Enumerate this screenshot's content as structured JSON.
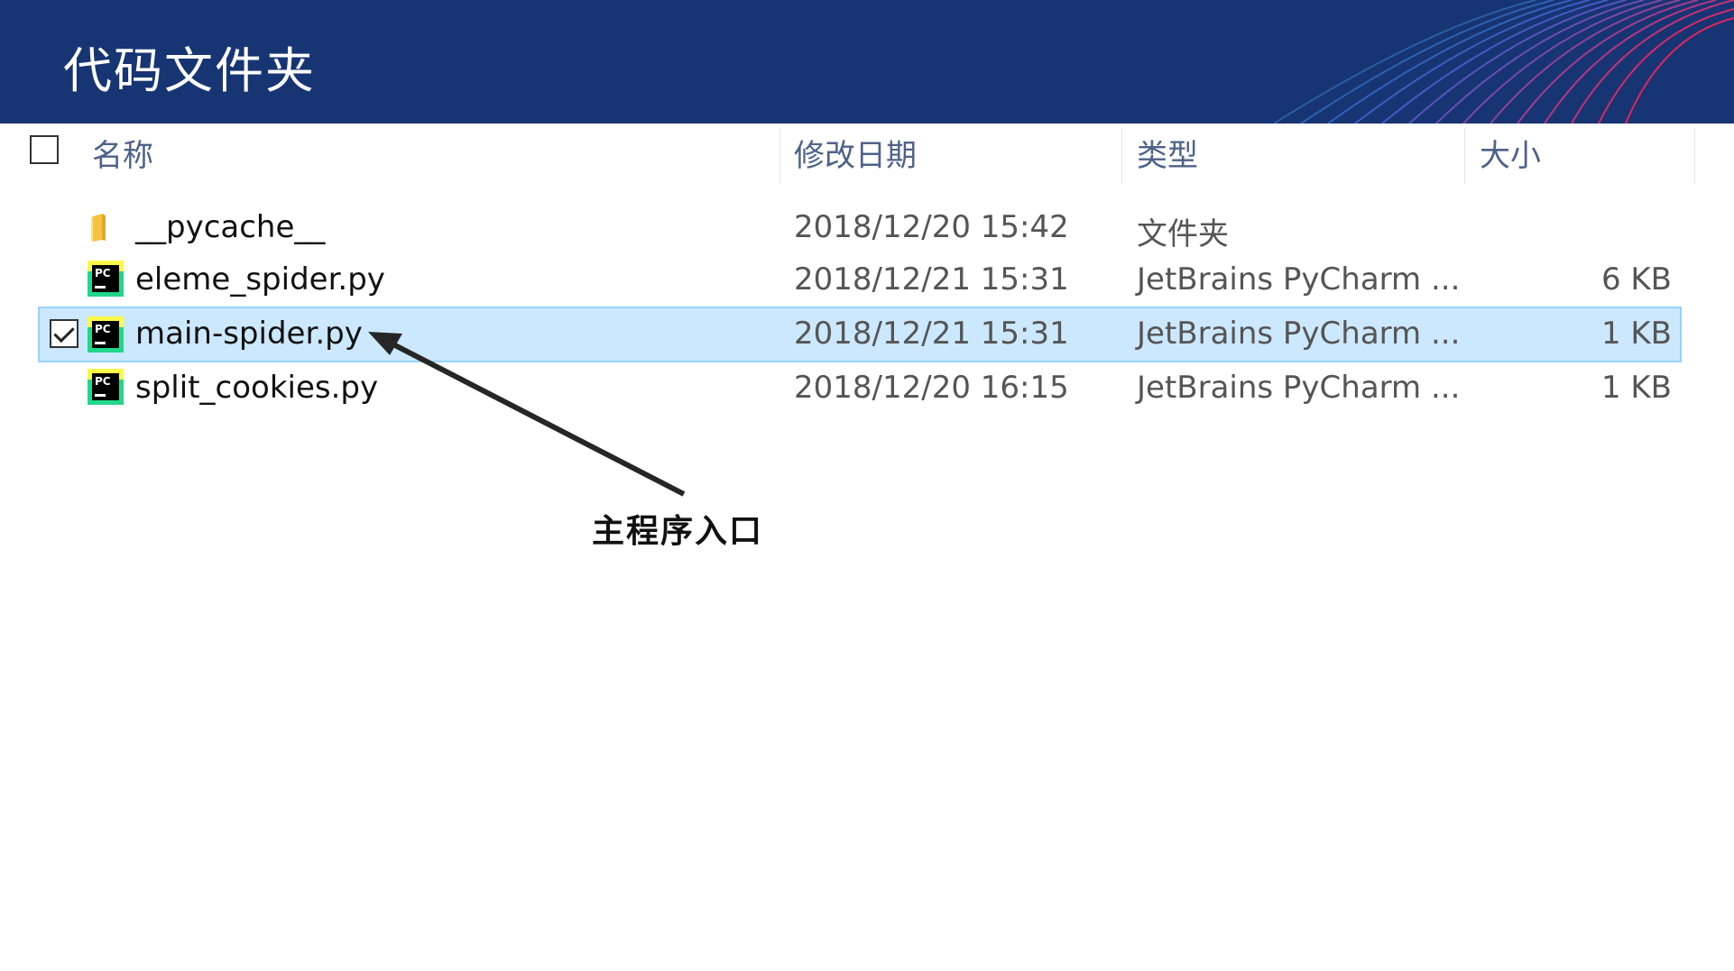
{
  "banner": {
    "title": "代码文件夹"
  },
  "columns": {
    "name": "名称",
    "date": "修改日期",
    "type": "类型",
    "size": "大小"
  },
  "files": [
    {
      "name": "__pycache__",
      "date": "2018/12/20 15:42",
      "type": "文件夹",
      "size": "",
      "icon": "folder-icon"
    },
    {
      "name": "eleme_spider.py",
      "date": "2018/12/21 15:31",
      "type": "JetBrains PyCharm ...",
      "size": "6 KB",
      "icon": "pycharm-file-icon"
    },
    {
      "name": "main-spider.py",
      "date": "2018/12/21 15:31",
      "type": "JetBrains PyCharm ...",
      "size": "1 KB",
      "icon": "pycharm-file-icon",
      "selected": true
    },
    {
      "name": "split_cookies.py",
      "date": "2018/12/20 16:15",
      "type": "JetBrains PyCharm ...",
      "size": "1 KB",
      "icon": "pycharm-file-icon"
    }
  ],
  "annotation": {
    "text": "主程序入口"
  },
  "colors": {
    "banner": "#173573",
    "selection": "#cce8ff",
    "selection_border": "#99d1ff",
    "header_text": "#4d6288"
  }
}
